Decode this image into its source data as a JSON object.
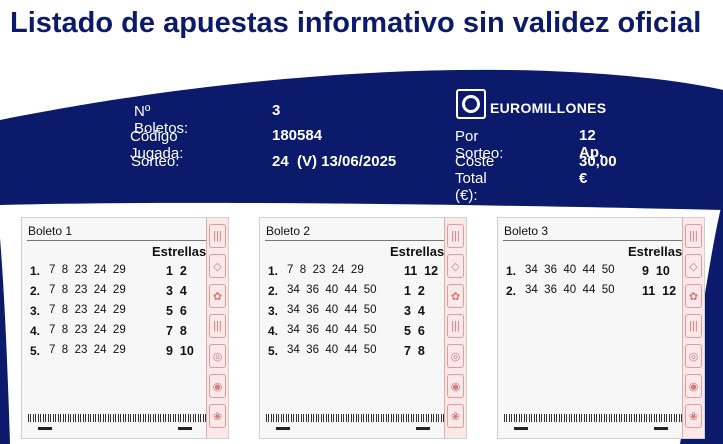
{
  "page": {
    "title": "Listado de apuestas informativo sin validez oficial"
  },
  "info": {
    "boletos_label": "Nº Boletos:",
    "boletos_value": "3",
    "codigo_label": "Código Jugada:",
    "codigo_value": "180584",
    "sorteo_label": "Sorteo:",
    "sorteo_value": "24  (V) 13/06/2025",
    "brand": "EUROMILLONES",
    "por_sorteo_label": "Por Sorteo:",
    "por_sorteo_value": "12 Ap.",
    "coste_label": "Coste Total (€):",
    "coste_value": "30,00 €"
  },
  "colors": {
    "navy": "#0b1a6b",
    "ticket_pink": "#fbe8e8",
    "ticket_border": "#e39b9b"
  },
  "tickets": [
    {
      "label": "Boleto 1",
      "stars_header": "Estrellas",
      "bets": [
        {
          "n": "1.",
          "nums": "7  8  23  24  29",
          "stars": "1  2"
        },
        {
          "n": "2.",
          "nums": "7  8  23  24  29",
          "stars": "3  4"
        },
        {
          "n": "3.",
          "nums": "7  8  23  24  29",
          "stars": "5  6"
        },
        {
          "n": "4.",
          "nums": "7  8  23  24  29",
          "stars": "7  8"
        },
        {
          "n": "5.",
          "nums": "7  8  23  24  29",
          "stars": "9  10"
        }
      ]
    },
    {
      "label": "Boleto 2",
      "stars_header": "Estrellas",
      "bets": [
        {
          "n": "1.",
          "nums": "7  8  23  24  29",
          "stars": "11  12"
        },
        {
          "n": "2.",
          "nums": "34  36  40  44  50",
          "stars": "1  2"
        },
        {
          "n": "3.",
          "nums": "34  36  40  44  50",
          "stars": "3  4"
        },
        {
          "n": "4.",
          "nums": "34  36  40  44  50",
          "stars": "5  6"
        },
        {
          "n": "5.",
          "nums": "34  36  40  44  50",
          "stars": "7  8"
        }
      ]
    },
    {
      "label": "Boleto 3",
      "stars_header": "Estrellas",
      "bets": [
        {
          "n": "1.",
          "nums": "34  36  40  44  50",
          "stars": "9  10"
        },
        {
          "n": "2.",
          "nums": "34  36  40  44  50",
          "stars": "11  12"
        }
      ]
    }
  ]
}
